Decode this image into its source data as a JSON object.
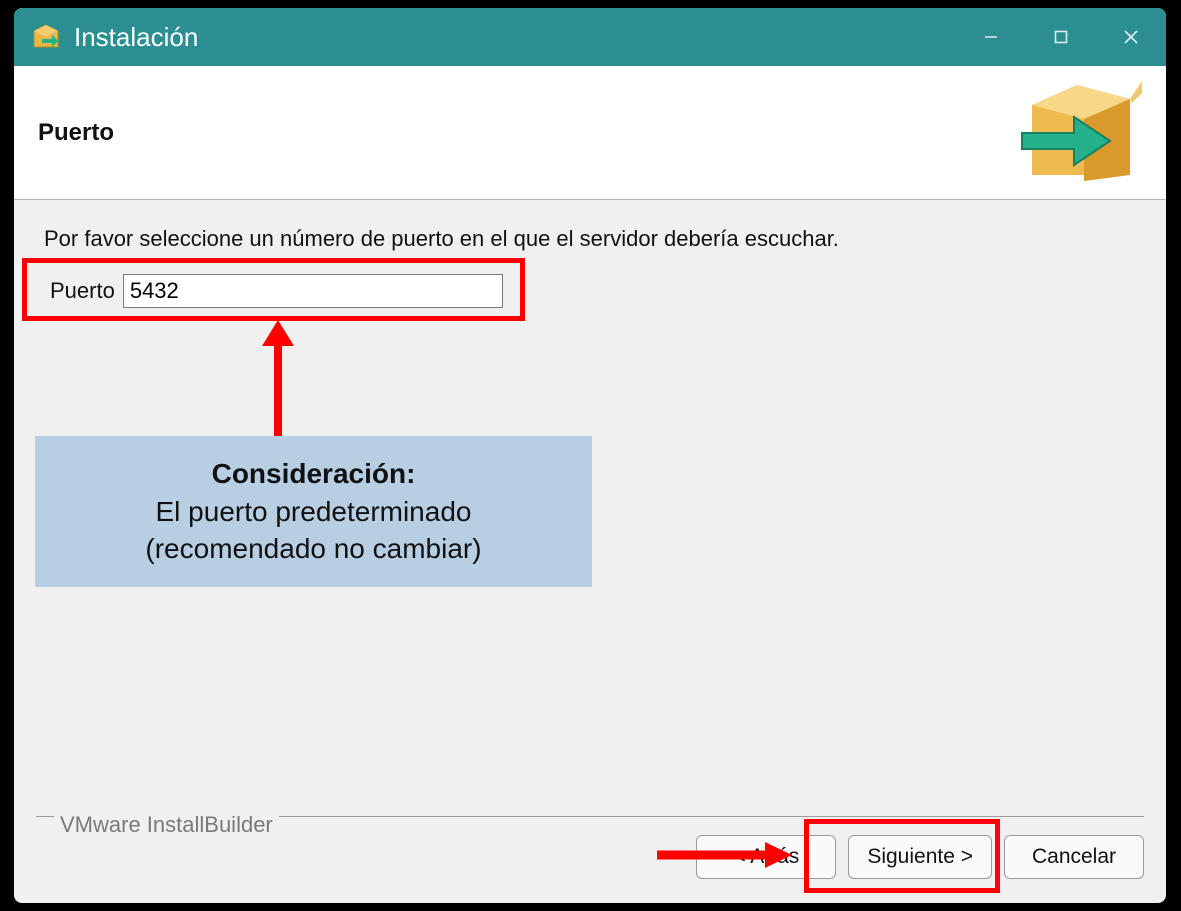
{
  "title": "Instalación",
  "header": {
    "heading": "Puerto"
  },
  "body": {
    "instruction": "Por favor seleccione un número de puerto en el que el servidor debería escuchar.",
    "port_label": "Puerto",
    "port_value": "5432"
  },
  "callout": {
    "title": "Consideración:",
    "line1": "El puerto predeterminado",
    "line2": "(recomendado no cambiar)"
  },
  "footer": {
    "brand": "VMware InstallBuilder",
    "back": "< Atrás",
    "next": "Siguiente >",
    "cancel": "Cancelar"
  },
  "colors": {
    "accent": "#2b8e91",
    "highlight": "#ff0000",
    "callout_bg": "#b8cee3"
  }
}
